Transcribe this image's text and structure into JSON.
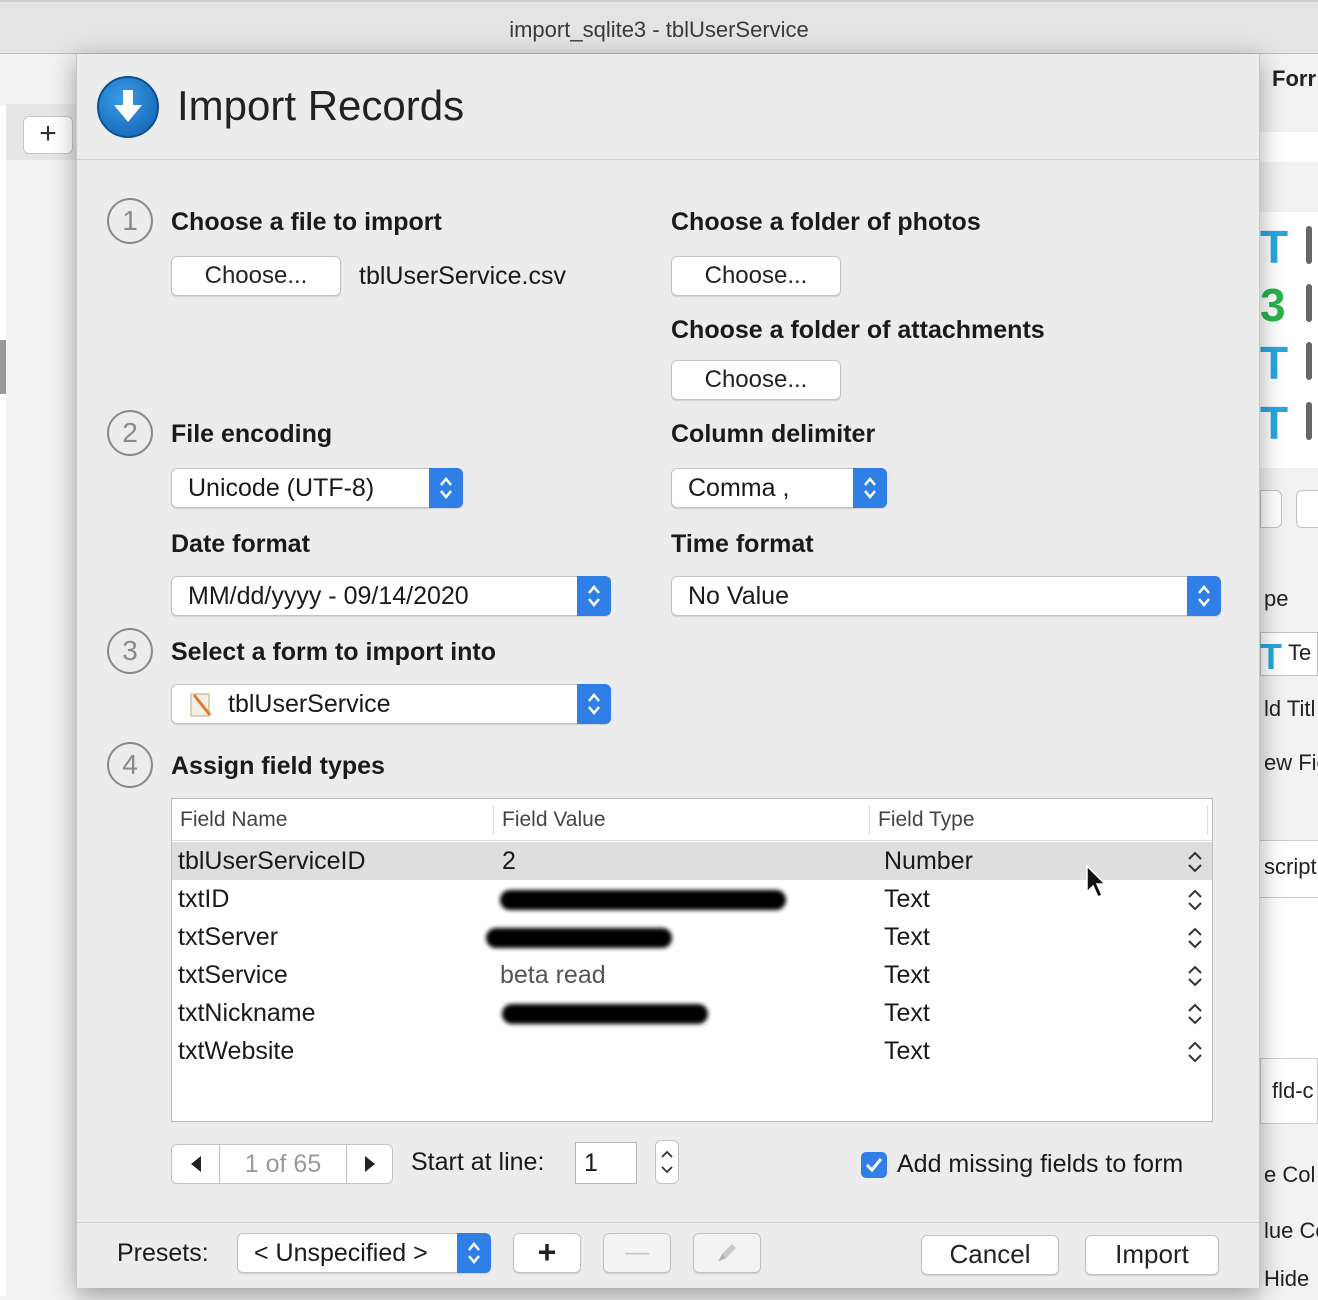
{
  "window": {
    "title": "import_sqlite3 - tblUserService"
  },
  "background": {
    "left_add_label": "+",
    "right_fragments": [
      "Forr",
      "pe",
      "Te",
      "ld Titl",
      "ew Fie",
      "script",
      "fld-c",
      "e Col",
      "lue Co",
      "Hide"
    ]
  },
  "dialog": {
    "title": "Import Records",
    "icon": "download-arrow-icon",
    "step1": {
      "number": "1",
      "label": "Choose a file to import",
      "button": "Choose...",
      "filename": "tblUserService.csv",
      "photos_label": "Choose a folder of photos",
      "photos_button": "Choose...",
      "attachments_label": "Choose a folder of attachments",
      "attachments_button": "Choose..."
    },
    "step2": {
      "number": "2",
      "encoding_label": "File encoding",
      "encoding_value": "Unicode (UTF-8)",
      "delimiter_label": "Column delimiter",
      "delimiter_value": "Comma ,",
      "date_label": "Date format",
      "date_value": "MM/dd/yyyy - 09/14/2020",
      "time_label": "Time format",
      "time_value": "No Value"
    },
    "step3": {
      "number": "3",
      "label": "Select a form to import into",
      "form_value": "tblUserService"
    },
    "step4": {
      "number": "4",
      "label": "Assign field types",
      "columns": [
        "Field Name",
        "Field Value",
        "Field Type"
      ],
      "rows": [
        {
          "name": "tblUserServiceID",
          "value": "2",
          "type": "Number",
          "redacted": false
        },
        {
          "name": "txtID",
          "value": "",
          "type": "Text",
          "redacted": true
        },
        {
          "name": "txtServer",
          "value": "",
          "type": "Text",
          "redacted": true
        },
        {
          "name": "txtService",
          "value": "beta read",
          "type": "Text",
          "redacted": false
        },
        {
          "name": "txtNickname",
          "value": "",
          "type": "Text",
          "redacted": true
        },
        {
          "name": "txtWebsite",
          "value": "",
          "type": "Text",
          "redacted": false
        }
      ]
    },
    "navigation": {
      "record_position": "1 of 65",
      "start_line_label": "Start at line:",
      "start_line_value": "1",
      "add_missing_label": "Add missing fields to form",
      "add_missing_checked": true
    },
    "footer": {
      "presets_label": "Presets:",
      "preset_value": "< Unspecified >",
      "add_label": "+",
      "remove_label": "—",
      "cancel_label": "Cancel",
      "import_label": "Import"
    }
  },
  "colors": {
    "accent": "#2f7fe6",
    "icon_blue": "#1b74c9"
  }
}
